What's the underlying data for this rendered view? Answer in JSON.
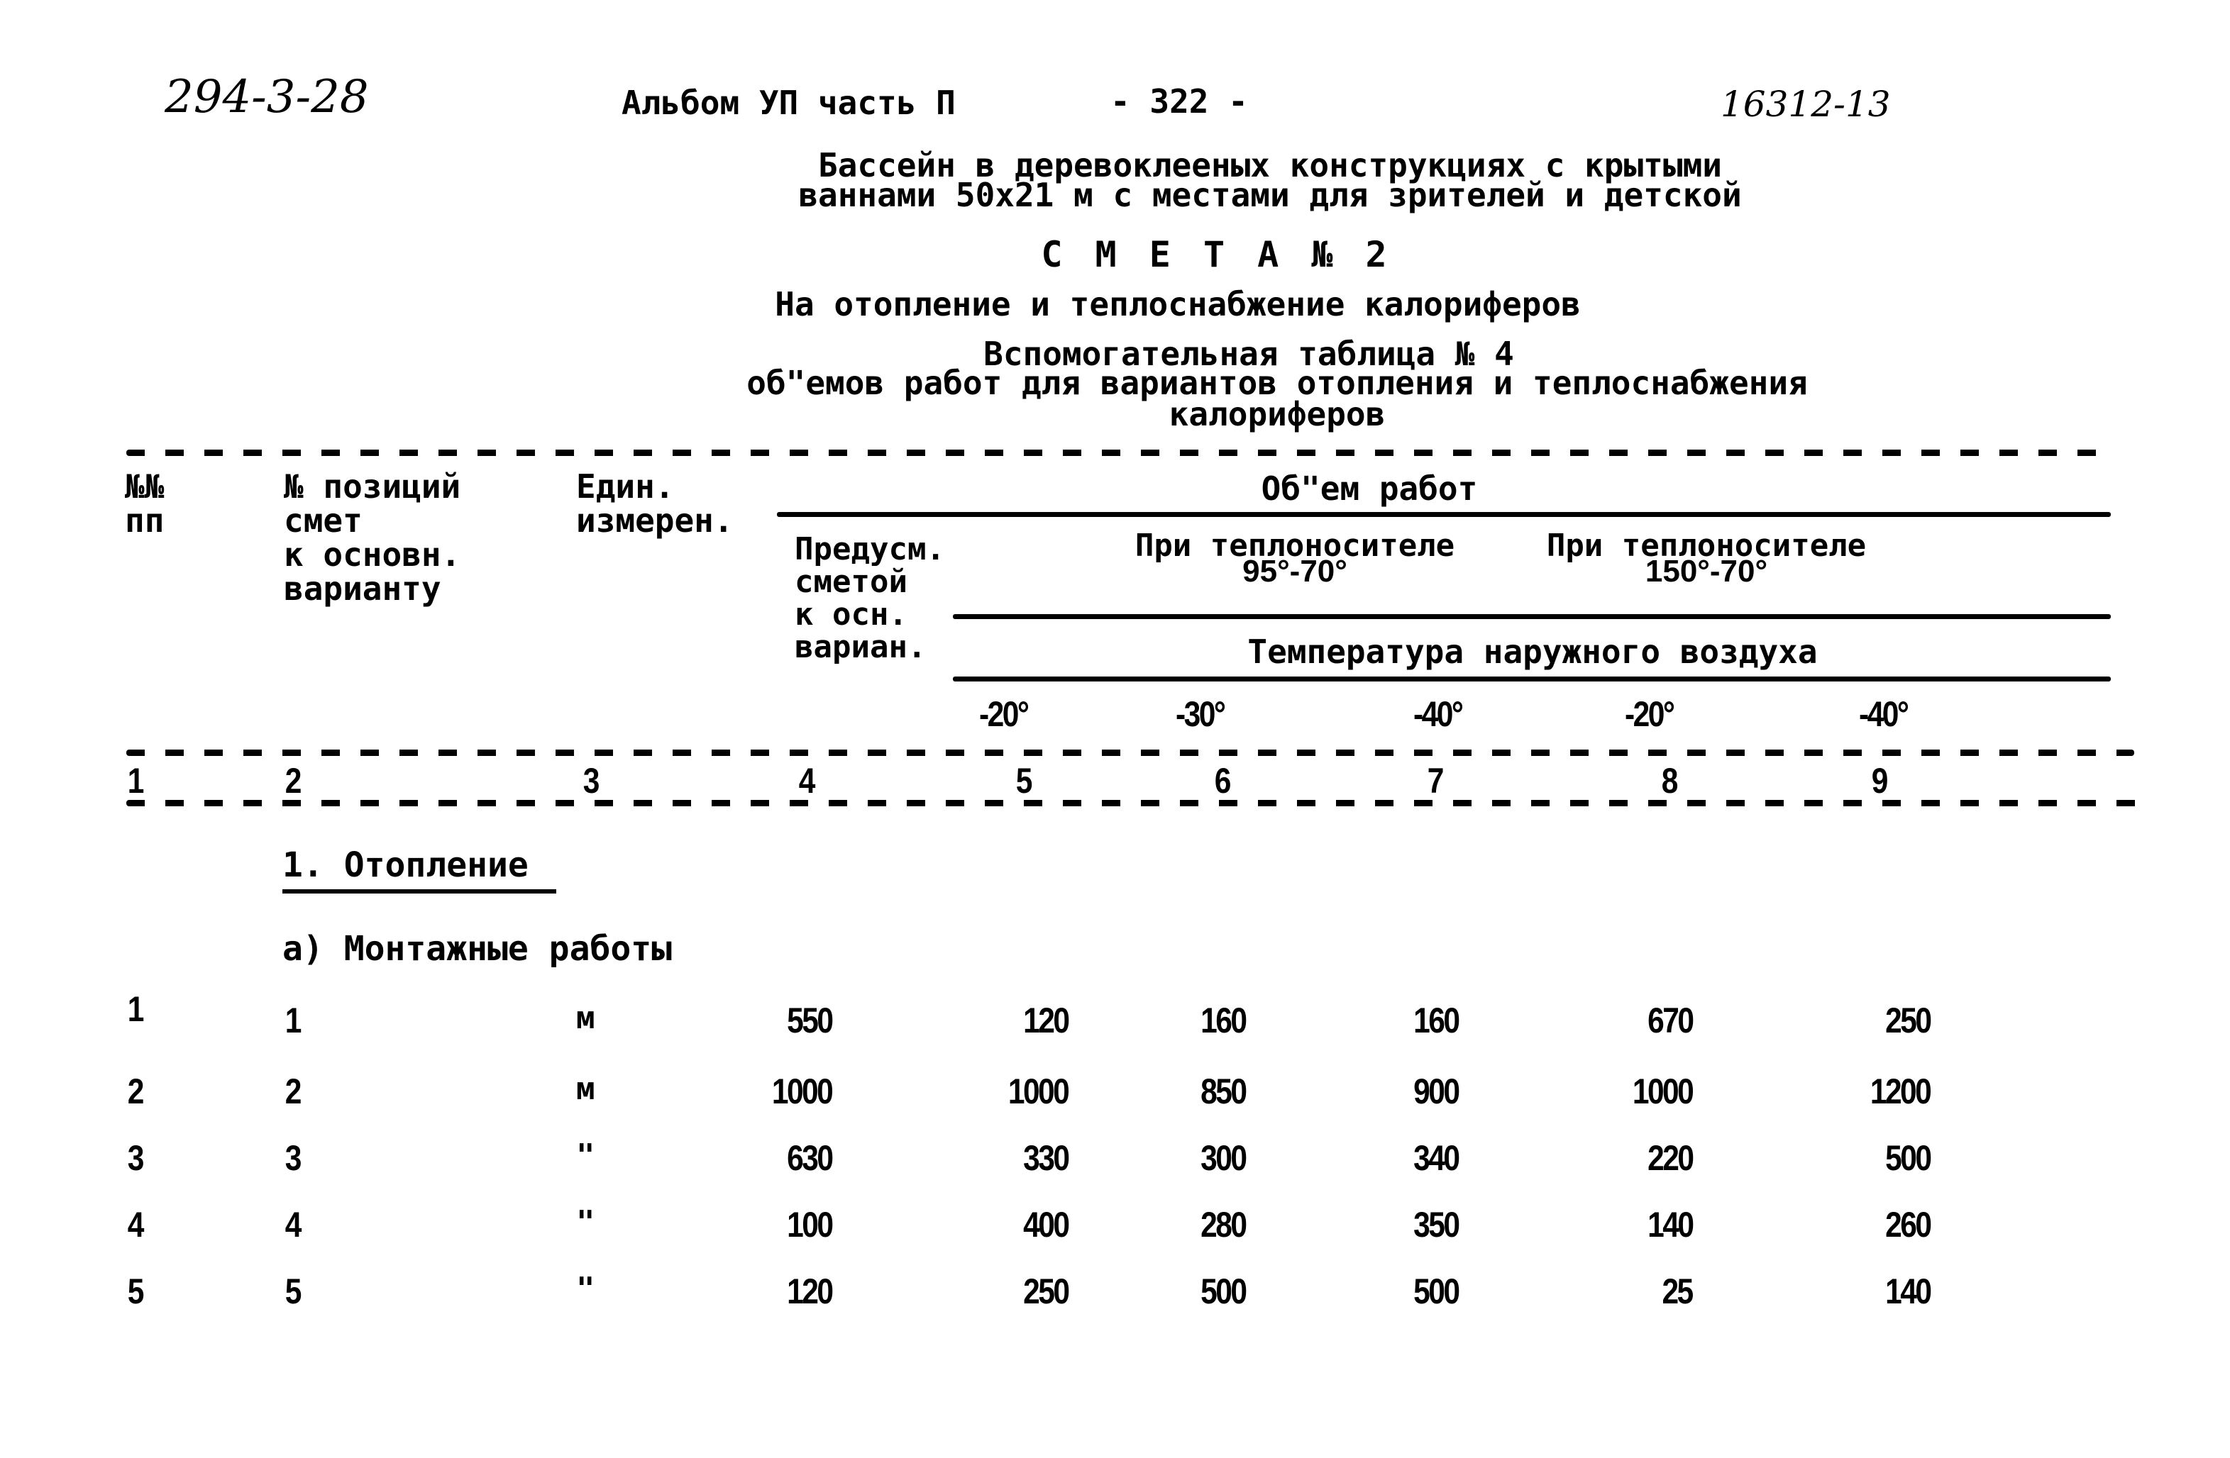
{
  "page_header": {
    "doc_code": "294-3-28",
    "album": "Альбом УП  часть П",
    "page_number": "- 322 -",
    "archive_number": "16312-13"
  },
  "title": {
    "project_line1": "Бассейн в деревоклееных конструкциях с крытыми",
    "project_line2": "ваннами 50х21 м с местами для зрителей и детской",
    "estimate": "С М Е Т А  № 2",
    "estimate_subject": "На отопление и теплоснабжение калориферов",
    "table_name": "Вспомогательная таблица № 4",
    "table_desc_line1": "об\"емов работ для вариантов  отопления и теплоснабжения",
    "table_desc_line2": "калориферов"
  },
  "table_header": {
    "col1": [
      "№№",
      "пп"
    ],
    "col2": [
      "№ позиций",
      "смет",
      "к основн.",
      "варианту"
    ],
    "col3": [
      "Един.",
      "измерен."
    ],
    "volume_group": "Об\"ем работ",
    "col4": [
      "Предусм.",
      "сметой",
      "к осн.",
      "вариан."
    ],
    "coolant_95_70": [
      "При теплоносителе",
      "95°-70°"
    ],
    "coolant_150_70": [
      "При теплоносителе",
      "150°-70°"
    ],
    "outdoor_temp": "Температура наружного воздуха",
    "temps": [
      "-20°",
      "-30°",
      "-40°",
      "-20°",
      "-40°"
    ],
    "column_numbers": [
      "1",
      "2",
      "3",
      "4",
      "5",
      "6",
      "7",
      "8",
      "9"
    ]
  },
  "sections": {
    "section_title": "1.  Отопление",
    "subsection_title": "а) Монтажные работы"
  },
  "rows": [
    {
      "n": "1",
      "pos": "1",
      "unit": "м",
      "base": "550",
      "c5": "120",
      "c6": "160",
      "c7": "160",
      "c8": "670",
      "c9": "250"
    },
    {
      "n": "2",
      "pos": "2",
      "unit": "м",
      "base": "1000",
      "c5": "1000",
      "c6": "850",
      "c7": "900",
      "c8": "1000",
      "c9": "1200"
    },
    {
      "n": "3",
      "pos": "3",
      "unit": "\"",
      "base": "630",
      "c5": "330",
      "c6": "300",
      "c7": "340",
      "c8": "220",
      "c9": "500"
    },
    {
      "n": "4",
      "pos": "4",
      "unit": "\"",
      "base": "100",
      "c5": "400",
      "c6": "280",
      "c7": "350",
      "c8": "140",
      "c9": "260"
    },
    {
      "n": "5",
      "pos": "5",
      "unit": "\"",
      "base": "120",
      "c5": "250",
      "c6": "500",
      "c7": "500",
      "c8": "25",
      "c9": "140"
    }
  ]
}
